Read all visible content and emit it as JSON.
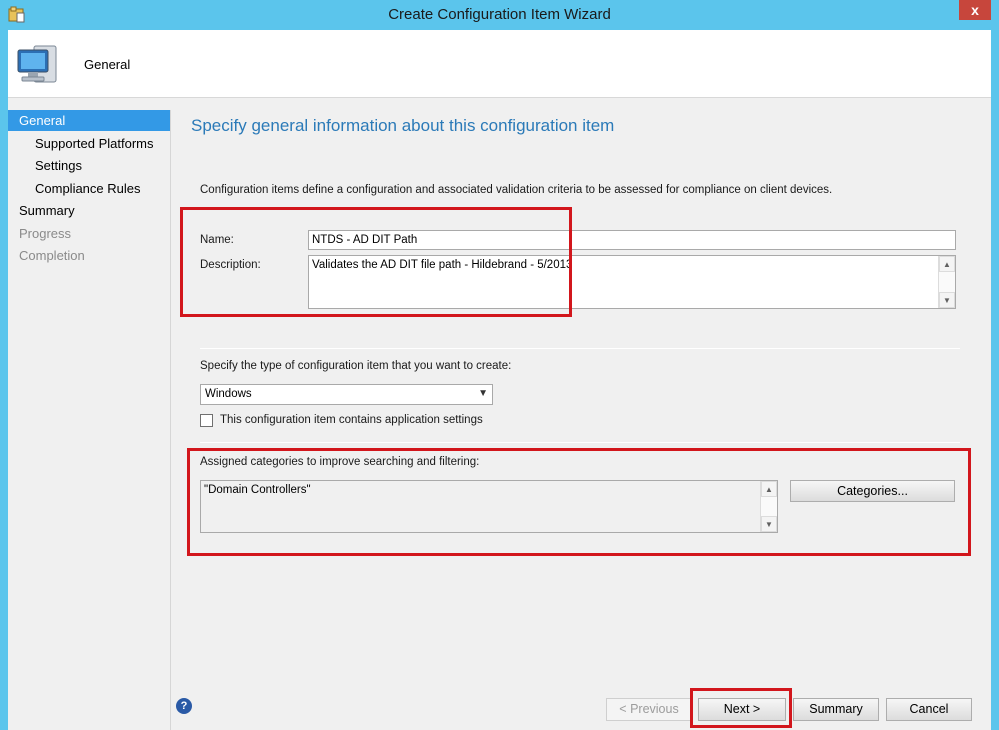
{
  "window": {
    "title": "Create Configuration Item Wizard",
    "close_label": "x"
  },
  "header": {
    "title": "General"
  },
  "nav": {
    "items": [
      {
        "label": "General",
        "state": "active"
      },
      {
        "label": "Supported Platforms",
        "state": "sub"
      },
      {
        "label": "Settings",
        "state": "sub"
      },
      {
        "label": "Compliance Rules",
        "state": "sub"
      },
      {
        "label": "Summary",
        "state": "normal"
      },
      {
        "label": "Progress",
        "state": "disabled"
      },
      {
        "label": "Completion",
        "state": "disabled"
      }
    ]
  },
  "page": {
    "heading": "Specify general information about this configuration item",
    "intro": "Configuration items define a configuration and associated validation criteria to be assessed for compliance on client devices.",
    "name_label": "Name:",
    "name_value": "NTDS - AD DIT Path",
    "description_label": "Description:",
    "description_value": "Validates the AD DIT file path - Hildebrand - 5/2013",
    "type_prompt": "Specify the type of configuration item that you want to create:",
    "type_value": "Windows",
    "app_settings_label": "This configuration item contains application settings",
    "app_settings_checked": false,
    "categories_label": "Assigned categories to improve searching and filtering:",
    "categories_value": "\"Domain Controllers\"",
    "categories_button": "Categories..."
  },
  "footer": {
    "help_label": "?",
    "previous": "< Previous",
    "next": "Next >",
    "summary": "Summary",
    "cancel": "Cancel"
  },
  "colors": {
    "titlebar": "#5bc5ec",
    "heading": "#2b7ab8",
    "nav_active": "#3399e6",
    "highlight": "#d2161c"
  }
}
